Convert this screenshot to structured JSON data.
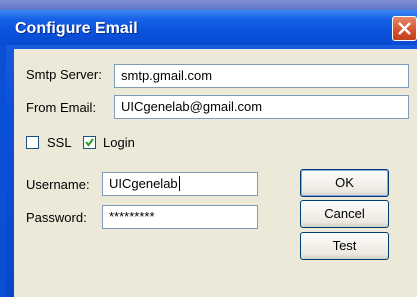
{
  "window": {
    "title": "Configure Email"
  },
  "form": {
    "smtp_label": "Smtp Server:",
    "smtp_value": "smtp.gmail.com",
    "from_label": "From Email:",
    "from_value": "UICgenelab@gmail.com",
    "ssl_label": "SSL",
    "ssl_checked": false,
    "login_label": "Login",
    "login_checked": true,
    "username_label": "Username:",
    "username_value": "UICgenelab",
    "password_label": "Password:",
    "password_value": "*********"
  },
  "buttons": {
    "ok": "OK",
    "cancel": "Cancel",
    "test": "Test"
  },
  "colors": {
    "title_bar": "#0a52dc",
    "dialog_bg": "#ece9d8",
    "close_button": "#d3512a"
  },
  "icons": {
    "close": "close-icon",
    "checkmark": "checkmark-icon"
  }
}
